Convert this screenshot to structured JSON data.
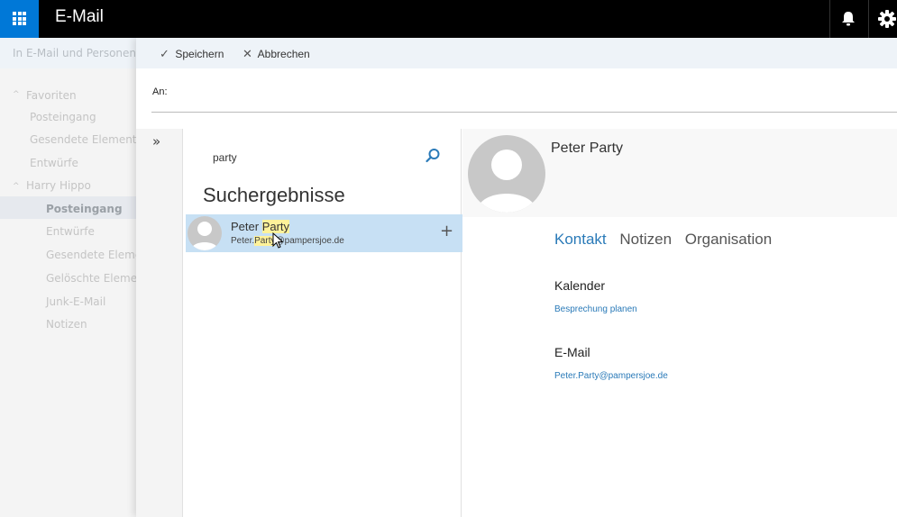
{
  "topbar": {
    "app_title": "E-Mail",
    "icons": [
      "app-launcher-icon",
      "bell-icon",
      "gear-icon"
    ],
    "accent_color": "#0078d7"
  },
  "leftnav": {
    "search_placeholder": "In E-Mail und Personen su...",
    "favorites": {
      "label": "Favoriten",
      "items": [
        "Posteingang",
        "Gesendete Elemente",
        "Entwürfe"
      ]
    },
    "account": {
      "label": "Harry Hippo",
      "items": [
        "Posteingang",
        "Entwürfe",
        "Gesendete Element",
        "Gelöschte Elemente",
        "Junk-E-Mail",
        "Notizen"
      ],
      "selected": "Posteingang"
    }
  },
  "compose": {
    "toolbar": {
      "save_label": "Speichern",
      "cancel_label": "Abbrechen"
    },
    "to_label": "An:"
  },
  "picker": {
    "query": "party",
    "results_title": "Suchergebnisse",
    "result": {
      "first": "Peter",
      "last": "Party",
      "email_prefix": "Peter.",
      "email_highlight": "Party",
      "email_suffix": "@pampersjoe.de"
    }
  },
  "detail": {
    "name": "Peter Party",
    "tabs": [
      "Kontakt",
      "Notizen",
      "Organisation"
    ],
    "active_tab": "Kontakt",
    "calendar": {
      "title": "Kalender",
      "link": "Besprechung planen"
    },
    "email": {
      "title": "E-Mail",
      "address": "Peter.Party@pampersjoe.de"
    },
    "link_color": "#2a7ab8"
  }
}
